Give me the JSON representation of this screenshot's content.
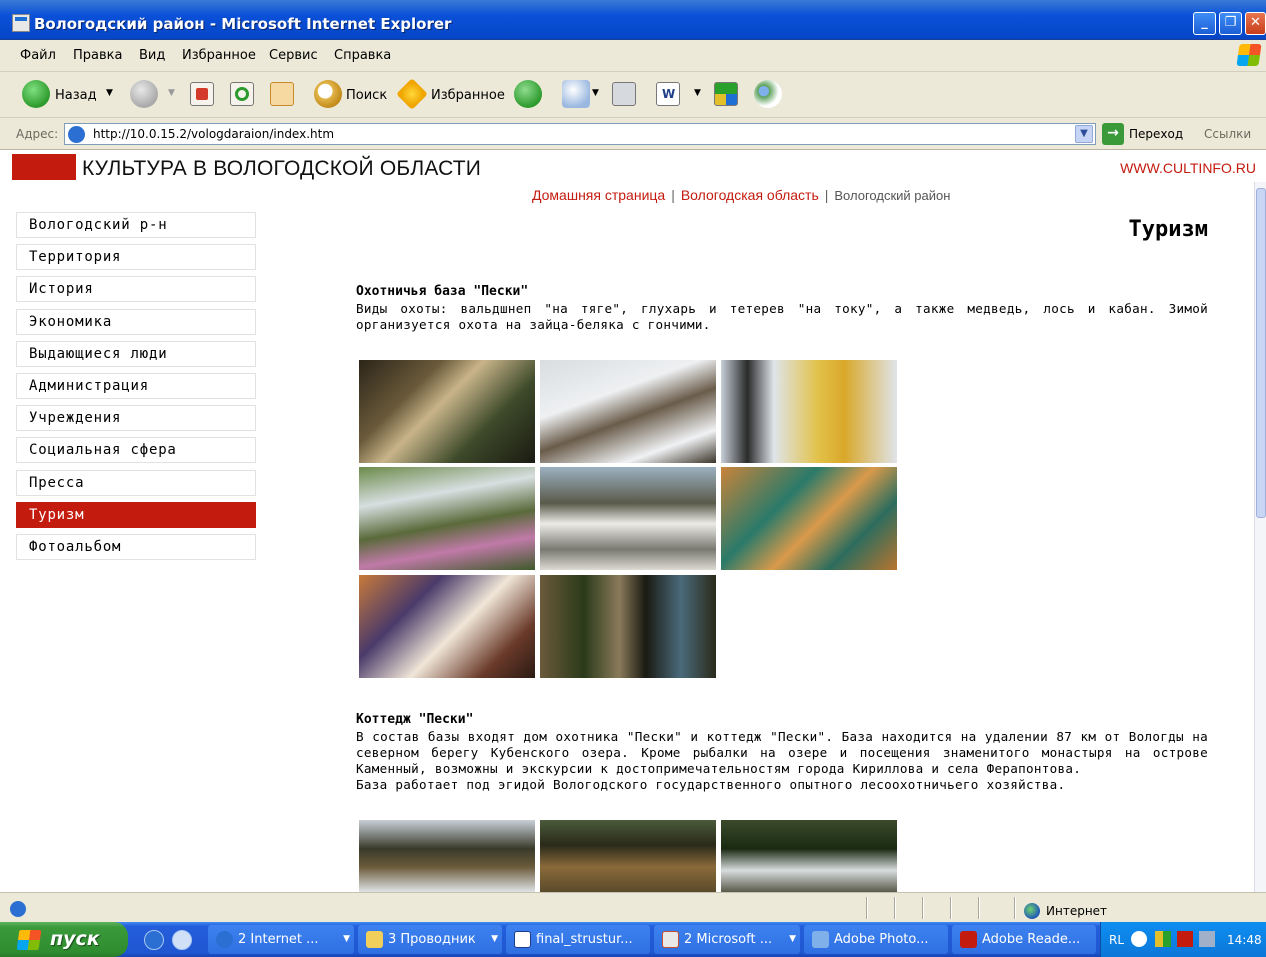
{
  "window": {
    "title": "Вологодский район - Microsoft Internet Explorer"
  },
  "menu": {
    "items": [
      "Файл",
      "Правка",
      "Вид",
      "Избранное",
      "Сервис",
      "Справка"
    ]
  },
  "toolbar": {
    "back_label": "Назад",
    "search_label": "Поиск",
    "favorites_label": "Избранное"
  },
  "address": {
    "label": "Адрес:",
    "url": "http://10.0.15.2/vologdaraion/index.htm",
    "go_label": "Переход",
    "links_label": "Ссылки"
  },
  "site": {
    "title": "КУЛЬТУРА В ВОЛОГОДСКОЙ ОБЛАСТИ",
    "url": "WWW.CULTINFO.RU"
  },
  "breadcrumbs": {
    "home": "Домашняя страница",
    "region": "Вологодская область",
    "current": "Вологодский район"
  },
  "page": {
    "heading": "Туризм"
  },
  "side_menu": {
    "items": [
      {
        "label": "Вологодский р-н",
        "active": false
      },
      {
        "label": "Территория",
        "active": false
      },
      {
        "label": "История",
        "active": false
      },
      {
        "label": "Экономика",
        "active": false
      },
      {
        "label": "Выдающиеся люди",
        "active": false
      },
      {
        "label": "Администрация",
        "active": false
      },
      {
        "label": "Учреждения",
        "active": false
      },
      {
        "label": "Социальная сфера",
        "active": false
      },
      {
        "label": "Пресса",
        "active": false
      },
      {
        "label": "Туризм",
        "active": true
      },
      {
        "label": "Фотоальбом",
        "active": false
      }
    ]
  },
  "sections": [
    {
      "title": "Охотничья база \"Пески\"",
      "text": "Виды охоты: вальдшнеп \"на тяге\", глухарь и тетерев \"на току\", а также медведь, лось и кабан. Зимой организуется охота на зайца-беляка с гончими."
    },
    {
      "title": "Коттедж \"Пески\"",
      "text": "В состав базы входят дом охотника \"Пески\" и коттедж \"Пески\". База находится на удалении 87 км от Вологды на северном берегу Кубенского озера. Кроме рыбалки на озере и посещения знаменитого монастыря на острове Каменный, возможны и экскурсии к достопримечательностям города Кириллова и села Ферапонтова.",
      "text2": "База работает под эгидой Вологодского государственного опытного лесоохотничьего хозяйства."
    }
  ],
  "status": {
    "zone": "Интернет"
  },
  "taskbar": {
    "start_label": "пуск",
    "buttons": [
      "2 Internet ...",
      "3 Проводник",
      "final_strustur...",
      "2 Microsoft ...",
      "Adobe Photo...",
      "Adobe Reade..."
    ],
    "lang": "RL",
    "clock": "14:48"
  },
  "colors": {
    "accent_red": "#c41b0f",
    "xp_blue": "#0546c6",
    "chrome": "#ece9d8"
  }
}
